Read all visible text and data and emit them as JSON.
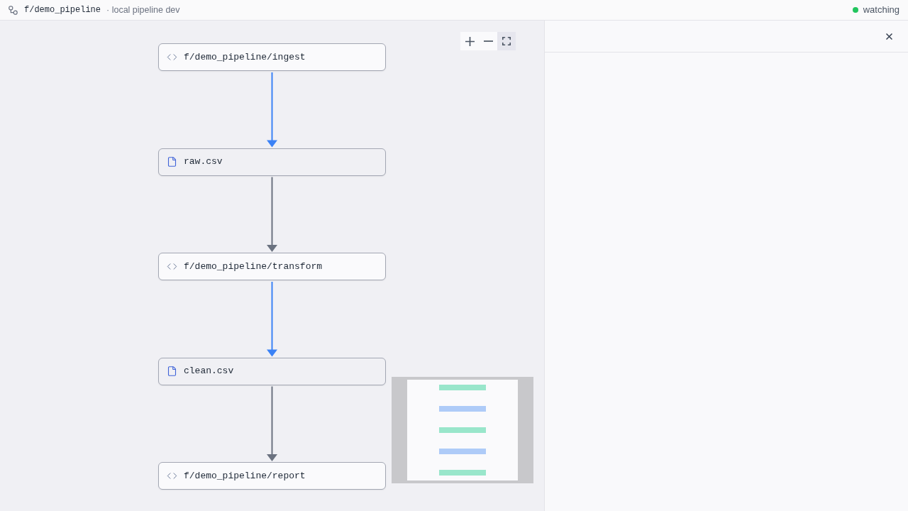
{
  "header": {
    "title": "f/demo_pipeline",
    "subtitle": "· local pipeline dev",
    "status": {
      "label": "watching",
      "active": true
    }
  },
  "canvas": {
    "zoom_controls": [
      {
        "kind": "zoom-in",
        "selected": false
      },
      {
        "kind": "zoom-out",
        "selected": false
      },
      {
        "kind": "fit",
        "selected": true
      }
    ],
    "nodes": [
      {
        "kind": "script",
        "label": "f/demo_pipeline/ingest"
      },
      {
        "kind": "asset",
        "label": "raw.csv"
      },
      {
        "kind": "script",
        "label": "f/demo_pipeline/transform"
      },
      {
        "kind": "asset",
        "label": "clean.csv"
      },
      {
        "kind": "script",
        "label": "f/demo_pipeline/report"
      }
    ]
  }
}
